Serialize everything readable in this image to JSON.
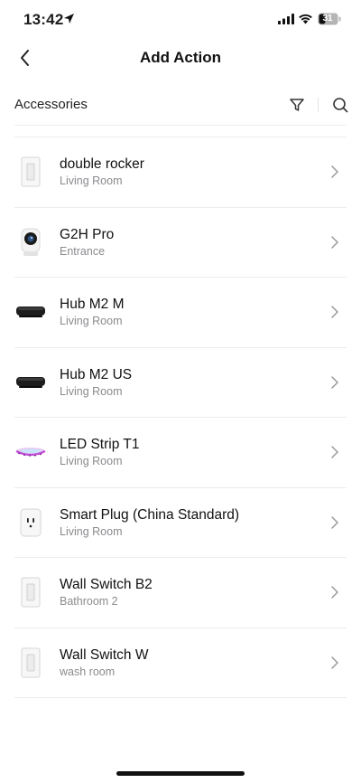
{
  "status_bar": {
    "time": "13:42",
    "battery": "31"
  },
  "nav": {
    "title": "Add Action"
  },
  "section": {
    "title": "Accessories"
  },
  "devices": [
    {
      "name": "double rocker",
      "room": "Living Room",
      "icon": "wall-switch-icon"
    },
    {
      "name": "G2H Pro",
      "room": "Entrance",
      "icon": "camera-icon"
    },
    {
      "name": "Hub M2 M",
      "room": "Living Room",
      "icon": "hub-icon"
    },
    {
      "name": "Hub M2 US",
      "room": "Living Room",
      "icon": "hub-icon"
    },
    {
      "name": "LED Strip T1",
      "room": "Living Room",
      "icon": "led-strip-icon"
    },
    {
      "name": "Smart Plug (China Standard)",
      "room": "Living Room",
      "icon": "smart-plug-icon"
    },
    {
      "name": "Wall Switch B2",
      "room": "Bathroom 2",
      "icon": "wall-switch-icon"
    },
    {
      "name": "Wall Switch W",
      "room": "wash room",
      "icon": "wall-switch-icon"
    }
  ]
}
